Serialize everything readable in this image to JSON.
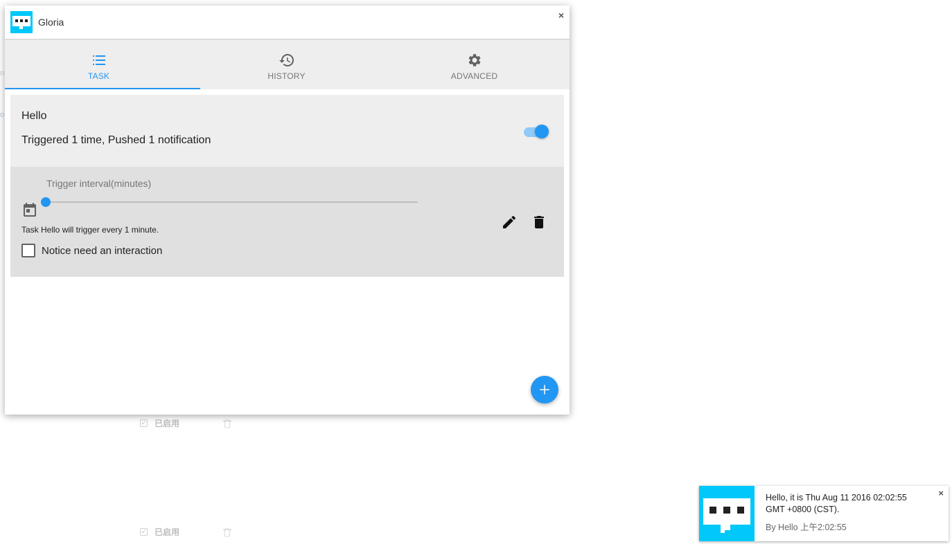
{
  "app": {
    "title": "Gloria",
    "close_symbol": "×",
    "icon": "chat-bubble-logo-icon"
  },
  "tabs": [
    {
      "label": "TASK",
      "icon": "list-icon",
      "active": true
    },
    {
      "label": "HISTORY",
      "icon": "history-icon",
      "active": false
    },
    {
      "label": "ADVANCED",
      "icon": "gear-icon",
      "active": false
    }
  ],
  "task": {
    "name": "Hello",
    "stats": "Triggered 1 time, Pushed 1 notification",
    "enabled": true,
    "interval_label": "Trigger interval(minutes)",
    "interval_value": 1,
    "interval_fraction": 0.0,
    "description": "Task Hello will trigger every 1 minute.",
    "interaction_label": "Notice need an interaction",
    "interaction_checked": false
  },
  "background": {
    "enabled_label_1": "已启用",
    "enabled_label_2": "已启用"
  },
  "notification": {
    "message": "Hello, it is Thu Aug 11 2016 02:02:55 GMT +0800 (CST).",
    "source": "By Hello 上午2:02:55",
    "close_symbol": "×"
  },
  "colors": {
    "accent": "#2196f3",
    "logo": "#00c8f8",
    "card": "#eeeeee",
    "detail": "#e0e0e0"
  }
}
